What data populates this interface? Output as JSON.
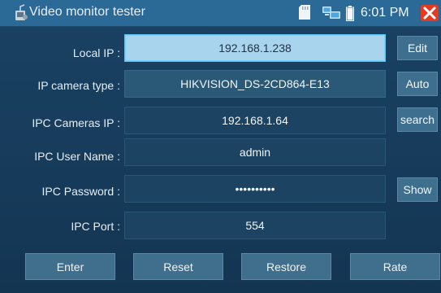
{
  "statusbar": {
    "app_title": "Video monitor tester",
    "time": "6:01 PM",
    "app_icon": "tester-icon",
    "sd_icon": "sd-card-icon",
    "network_icon": "network-icon",
    "battery_icon": "battery-icon",
    "close_icon": "close-icon",
    "close_color": "#e53a22"
  },
  "form": {
    "rows": [
      {
        "label": "Local IP :",
        "value": "192.168.1.238",
        "button": "Edit"
      },
      {
        "label": "IP camera type :",
        "value": "HIKVISION_DS-2CD864-E13",
        "button": "Auto"
      },
      {
        "label": "IPC Cameras IP :",
        "value": "192.168.1.64",
        "button": "search"
      },
      {
        "label": "IPC User Name :",
        "value": "admin",
        "button": ""
      },
      {
        "label": "IPC Password :",
        "value": "••••••••••",
        "button": "Show"
      },
      {
        "label": "IPC Port :",
        "value": "554",
        "button": ""
      }
    ]
  },
  "actions": {
    "enter": "Enter",
    "reset": "Reset",
    "restore": "Restore",
    "rate": "Rate"
  },
  "colors": {
    "background": "#173c5c",
    "statusbar": "#2b6a97",
    "active_field": "#a8d4ee",
    "active_border": "#5cc7f2",
    "button": "#3f6f8c"
  }
}
